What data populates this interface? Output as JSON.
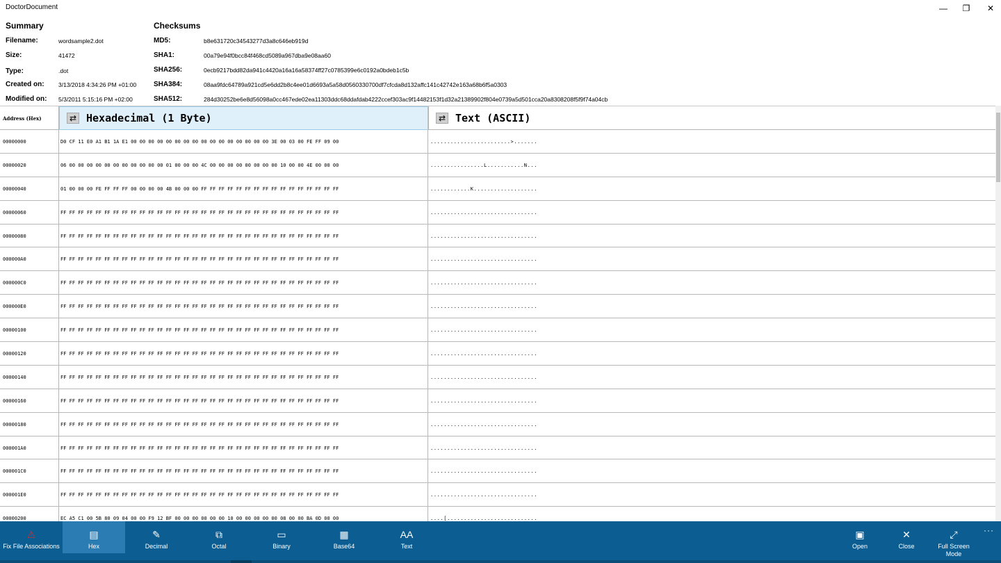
{
  "window": {
    "title": "DoctorDocument",
    "minimize": "—",
    "restore": "❐",
    "close": "✕"
  },
  "summary": {
    "heading": "Summary",
    "filename_label": "Filename:",
    "filename": "wordsample2.dot",
    "size_label": "Size:",
    "size": "41472",
    "type_label": "Type:",
    "type": ".dot",
    "created_label": "Created on:",
    "created": "3/13/2018 4:34:26 PM +01:00",
    "modified_label": "Modified on:",
    "modified": "5/3/2011 5:15:16 PM +02:00"
  },
  "checksums": {
    "heading": "Checksums",
    "md5_label": "MD5:",
    "md5": "b8e631720c34543277d3a8c646eb919d",
    "sha1_label": "SHA1:",
    "sha1": "00a79e94f0bcc84f468cd5089a967dba9e08aa60",
    "sha256_label": "SHA256:",
    "sha256": "0ecb9217bdd82da941c4420a16a16a58374ff27c0785399e6c0192a0bdeb1c5b",
    "sha384_label": "SHA384:",
    "sha384": "08aa9fdc64789a921cd5e6dd2b8c4ee01d6693a5a58d0560330700df7cfcda8d132affc141c42742e163a68b6f5a0303",
    "sha512_label": "SHA512:",
    "sha512": "284d30252be6e8d56098a0cc467ede02ea11303ddc68ddafdab4222ccef303ac9f14482153f1d32a21389902f804e0739a5d501cca20a8308208f5f9f74a04cb"
  },
  "table": {
    "address_header": "Address (Hex)",
    "hex_header": "Hexadecimal (1 Byte)",
    "text_header": "Text (ASCII)",
    "swap_icon_glyph": "⇄",
    "rows": [
      {
        "addr": "00000000",
        "hex": "D0 CF 11 E0 A1 B1 1A E1 00 00 00 00 00 00 00 00 00 00 00 00 00 00 00 00 3E 00 03 00 FE FF 09 00",
        "text": "........................>......."
      },
      {
        "addr": "00000020",
        "hex": "06 00 00 00 00 00 00 00 00 00 00 00 01 00 00 00 4C 00 00 00 00 00 00 00 00 10 00 00 4E 00 00 00",
        "text": "................L...........N..."
      },
      {
        "addr": "00000040",
        "hex": "01 00 00 00 FE FF FF FF 00 00 00 00 4B 00 00 00 FF FF FF FF FF FF FF FF FF FF FF FF FF FF FF FF",
        "text": "............K..................."
      },
      {
        "addr": "00000060",
        "hex": "FF FF FF FF FF FF FF FF FF FF FF FF FF FF FF FF FF FF FF FF FF FF FF FF FF FF FF FF FF FF FF FF",
        "text": "................................"
      },
      {
        "addr": "00000080",
        "hex": "FF FF FF FF FF FF FF FF FF FF FF FF FF FF FF FF FF FF FF FF FF FF FF FF FF FF FF FF FF FF FF FF",
        "text": "................................"
      },
      {
        "addr": "000000A0",
        "hex": "FF FF FF FF FF FF FF FF FF FF FF FF FF FF FF FF FF FF FF FF FF FF FF FF FF FF FF FF FF FF FF FF",
        "text": "................................"
      },
      {
        "addr": "000000C0",
        "hex": "FF FF FF FF FF FF FF FF FF FF FF FF FF FF FF FF FF FF FF FF FF FF FF FF FF FF FF FF FF FF FF FF",
        "text": "................................"
      },
      {
        "addr": "000000E0",
        "hex": "FF FF FF FF FF FF FF FF FF FF FF FF FF FF FF FF FF FF FF FF FF FF FF FF FF FF FF FF FF FF FF FF",
        "text": "................................"
      },
      {
        "addr": "00000100",
        "hex": "FF FF FF FF FF FF FF FF FF FF FF FF FF FF FF FF FF FF FF FF FF FF FF FF FF FF FF FF FF FF FF FF",
        "text": "................................"
      },
      {
        "addr": "00000120",
        "hex": "FF FF FF FF FF FF FF FF FF FF FF FF FF FF FF FF FF FF FF FF FF FF FF FF FF FF FF FF FF FF FF FF",
        "text": "................................"
      },
      {
        "addr": "00000140",
        "hex": "FF FF FF FF FF FF FF FF FF FF FF FF FF FF FF FF FF FF FF FF FF FF FF FF FF FF FF FF FF FF FF FF",
        "text": "................................"
      },
      {
        "addr": "00000160",
        "hex": "FF FF FF FF FF FF FF FF FF FF FF FF FF FF FF FF FF FF FF FF FF FF FF FF FF FF FF FF FF FF FF FF",
        "text": "................................"
      },
      {
        "addr": "00000180",
        "hex": "FF FF FF FF FF FF FF FF FF FF FF FF FF FF FF FF FF FF FF FF FF FF FF FF FF FF FF FF FF FF FF FF",
        "text": "................................"
      },
      {
        "addr": "000001A0",
        "hex": "FF FF FF FF FF FF FF FF FF FF FF FF FF FF FF FF FF FF FF FF FF FF FF FF FF FF FF FF FF FF FF FF",
        "text": "................................"
      },
      {
        "addr": "000001C0",
        "hex": "FF FF FF FF FF FF FF FF FF FF FF FF FF FF FF FF FF FF FF FF FF FF FF FF FF FF FF FF FF FF FF FF",
        "text": "................................"
      },
      {
        "addr": "000001E0",
        "hex": "FF FF FF FF FF FF FF FF FF FF FF FF FF FF FF FF FF FF FF FF FF FF FF FF FF FF FF FF FF FF FF FF",
        "text": "................................"
      },
      {
        "addr": "00000200",
        "hex": "EC A5 C1 00 5B 80 09 04 00 00 F9 12 BF 00 00 00 00 00 00 10 00 00 00 00 00 08 00 00 BA 0D 00 00",
        "text": "....[..........................."
      }
    ]
  },
  "appbar": {
    "colors": {
      "background": "#0c5e92",
      "selected": "#2a7cb3",
      "warning": "#d42e2e"
    },
    "buttons": [
      {
        "id": "fix",
        "label": "Fix File Associations",
        "icon": "warning-icon",
        "glyph": "⚠"
      },
      {
        "id": "hex",
        "label": "Hex",
        "icon": "hex-view-icon",
        "glyph": "▤",
        "selected": true
      },
      {
        "id": "decimal",
        "label": "Decimal",
        "icon": "pencil-icon",
        "glyph": "✎"
      },
      {
        "id": "octal",
        "label": "Octal",
        "icon": "octal-view-icon",
        "glyph": "⧉"
      },
      {
        "id": "binary",
        "label": "Binary",
        "icon": "binary-view-icon",
        "glyph": "▭"
      },
      {
        "id": "base64",
        "label": "Base64",
        "icon": "base64-view-icon",
        "glyph": "▦"
      },
      {
        "id": "text",
        "label": "Text",
        "icon": "font-size-icon",
        "glyph": "AA"
      },
      {
        "id": "open",
        "label": "Open",
        "icon": "open-folder-icon",
        "glyph": "▣"
      },
      {
        "id": "close",
        "label": "Close",
        "icon": "close-icon",
        "glyph": "✕"
      },
      {
        "id": "fullscreen",
        "label": "Full Screen Mode",
        "icon": "fullscreen-icon",
        "glyph": "⤢"
      }
    ],
    "more": "···"
  }
}
